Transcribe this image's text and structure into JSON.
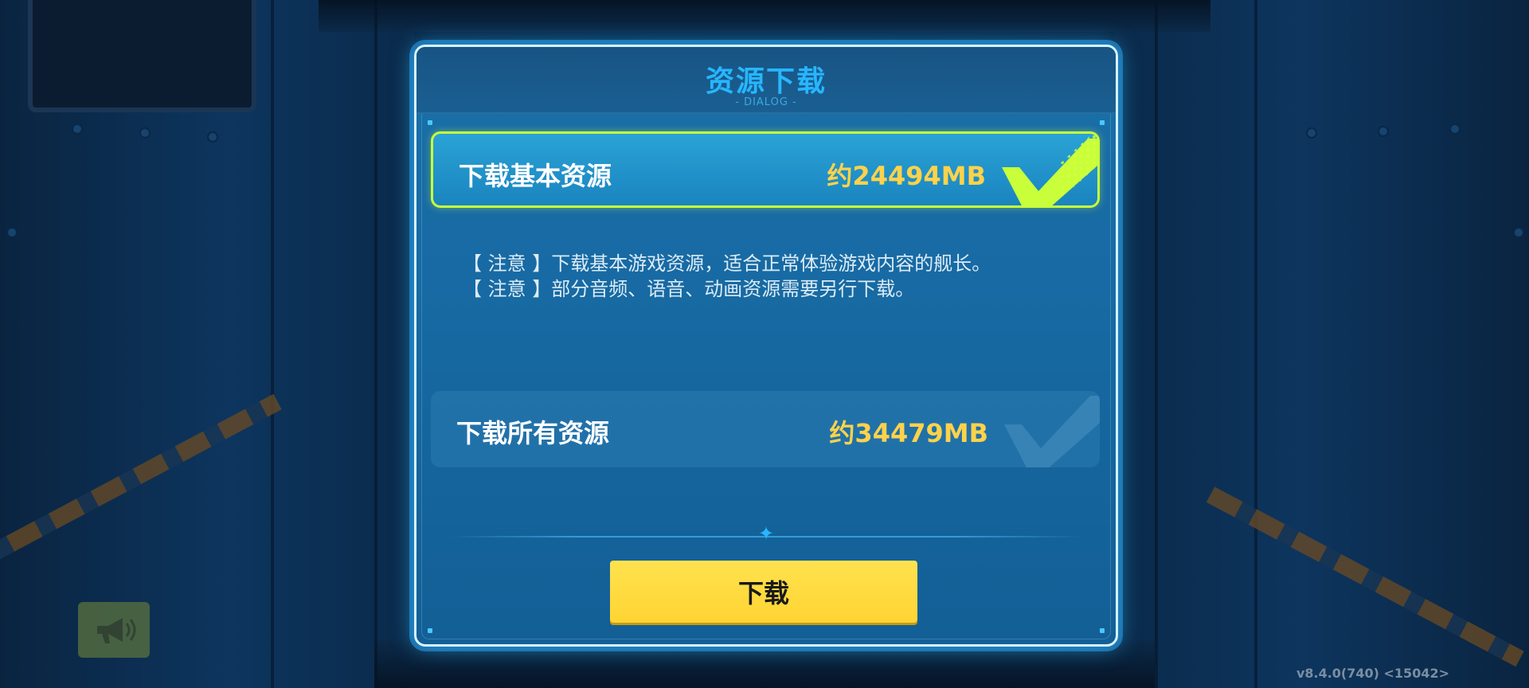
{
  "dialog": {
    "title": "资源下载",
    "subtitle": "- DIALOG -",
    "options": [
      {
        "label": "下载基本资源",
        "size": "约24494MB",
        "selected": true
      },
      {
        "label": "下载所有资源",
        "size": "约34479MB",
        "selected": false
      }
    ],
    "notes": [
      "【 注意 】下载基本游戏资源，适合正常体验游戏内容的舰长。",
      "【 注意 】部分音频、语音、动画资源需要另行下载。"
    ],
    "download_label": "下载"
  },
  "announce_icon": "megaphone-icon",
  "version": "v8.4.0(740) <15042>",
  "colors": {
    "title": "#27b6ff",
    "size_text": "#ffd24a",
    "selected_border": "#c8ff3a",
    "button": "#ffd433"
  }
}
